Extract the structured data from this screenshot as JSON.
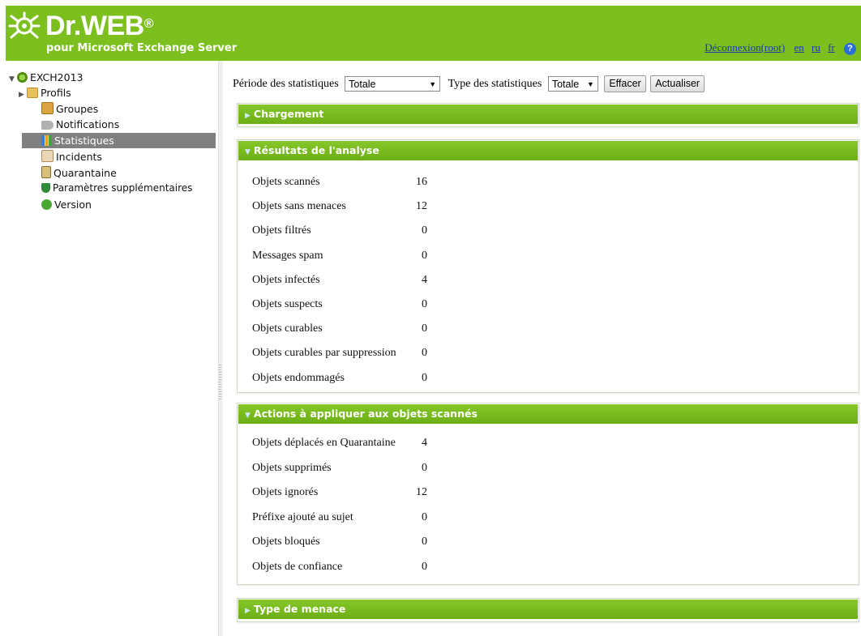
{
  "header": {
    "brand": "Dr.WEB",
    "registered": "®",
    "subtitle": "pour Microsoft Exchange Server",
    "logout": "Déconnexion(root)",
    "lang_en": "en",
    "lang_ru": "ru",
    "lang_fr": "fr",
    "help": "?"
  },
  "sidebar": {
    "root": "EXCH2013",
    "items": [
      {
        "label": "Profils",
        "icon": "folder-icon"
      },
      {
        "label": "Groupes",
        "icon": "group-icon"
      },
      {
        "label": "Notifications",
        "icon": "megaphone-icon"
      },
      {
        "label": "Statistiques",
        "icon": "chart-icon"
      },
      {
        "label": "Incidents",
        "icon": "incident-icon"
      },
      {
        "label": "Quarantaine",
        "icon": "quarantine-icon"
      },
      {
        "label": "Paramètres supplémentaires",
        "icon": "shield-icon"
      },
      {
        "label": "Version",
        "icon": "info-icon"
      }
    ]
  },
  "toolbar": {
    "period_label": "Période des statistiques",
    "period_value": "Totale",
    "type_label": "Type des statistiques",
    "type_value": "Totale",
    "clear_btn": "Effacer",
    "refresh_btn": "Actualiser"
  },
  "panels": {
    "load": {
      "title": "Chargement"
    },
    "results": {
      "title": "Résultats de l'analyse",
      "rows": [
        {
          "label": "Objets scannés",
          "value": "16"
        },
        {
          "label": "Objets sans menaces",
          "value": "12"
        },
        {
          "label": "Objets filtrés",
          "value": "0"
        },
        {
          "label": "Messages spam",
          "value": "0"
        },
        {
          "label": "Objets infectés",
          "value": "4"
        },
        {
          "label": "Objets suspects",
          "value": "0"
        },
        {
          "label": "Objets curables",
          "value": "0"
        },
        {
          "label": "Objets curables par suppression",
          "value": "0"
        },
        {
          "label": "Objets endommagés",
          "value": "0"
        }
      ]
    },
    "actions": {
      "title": "Actions à appliquer aux objets scannés",
      "rows": [
        {
          "label": "Objets déplacés en Quarantaine",
          "value": "4"
        },
        {
          "label": "Objets supprimés",
          "value": "0"
        },
        {
          "label": "Objets ignorés",
          "value": "12"
        },
        {
          "label": "Préfixe ajouté au sujet",
          "value": "0"
        },
        {
          "label": "Objets bloqués",
          "value": "0"
        },
        {
          "label": "Objets de confiance",
          "value": "0"
        }
      ]
    },
    "threat": {
      "title": "Type de menace"
    }
  },
  "colors": {
    "brand_green": "#7cbf1e",
    "selected": "#808080",
    "link": "#1a3aa8"
  }
}
